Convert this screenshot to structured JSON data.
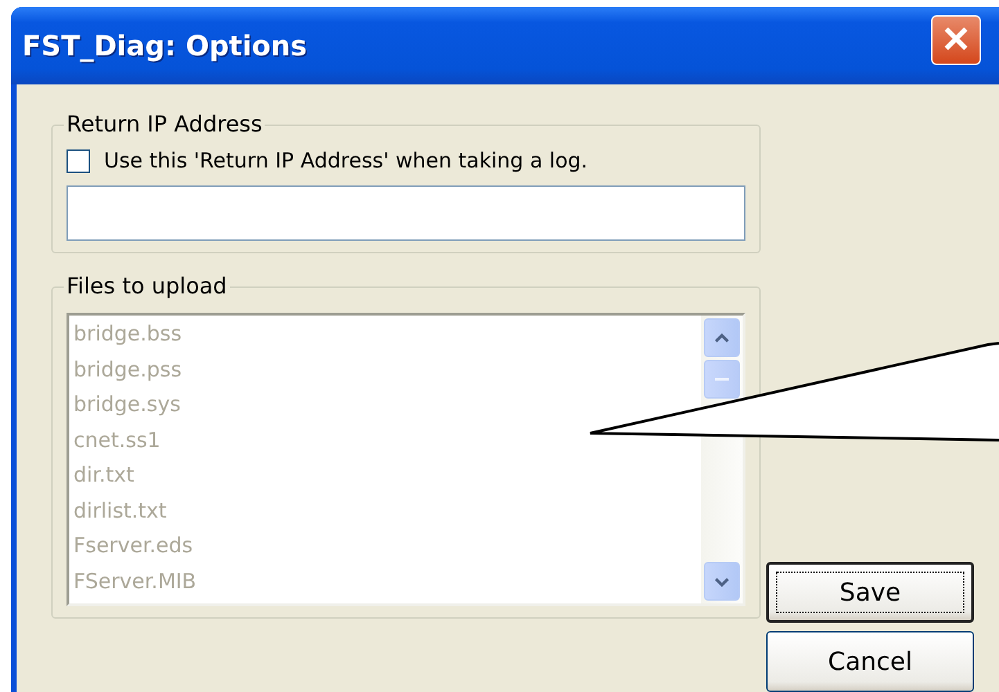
{
  "window": {
    "title": "FST_Diag: Options"
  },
  "return_ip": {
    "legend": "Return IP Address",
    "checkbox": {
      "label": "Use this 'Return IP Address' when taking a log.",
      "checked": false
    }
  },
  "files": {
    "legend": "Files to upload",
    "disabled": true,
    "items": [
      {
        "name": "bridge.bss"
      },
      {
        "name": "bridge.pss"
      },
      {
        "name": "bridge.sys"
      },
      {
        "name": "cnet.ss1"
      },
      {
        "name": "dir.txt"
      },
      {
        "name": "dirlist.txt"
      },
      {
        "name": "Fserver.eds"
      },
      {
        "name": "FServer.MIB"
      }
    ]
  },
  "buttons": [
    {
      "label": "Save",
      "default": true
    },
    {
      "label": "Cancel",
      "default": false
    }
  ]
}
